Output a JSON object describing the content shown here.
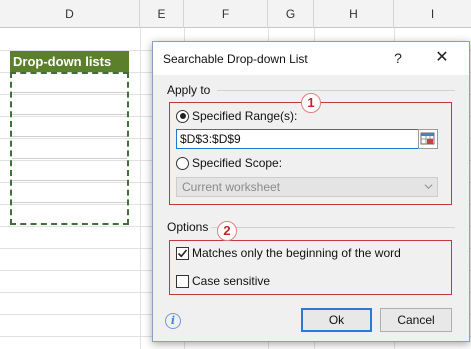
{
  "sheet": {
    "columns": [
      "D",
      "E",
      "F",
      "G",
      "H",
      "I"
    ],
    "header_cell": "Drop-down lists",
    "header_color": "#5b7f2a"
  },
  "dialog": {
    "title": "Searchable Drop-down List",
    "help_label": "?",
    "close_label": "✕",
    "apply_to": {
      "label": "Apply to",
      "badge": "1",
      "specified_range_label": "Specified Range(s):",
      "specified_range_checked": true,
      "range_value": "$D$3:$D$9",
      "specified_scope_label": "Specified Scope:",
      "specified_scope_checked": false,
      "scope_value": "Current worksheet"
    },
    "options": {
      "label": "Options",
      "badge": "2",
      "match_beginning_label": "Matches only the beginning of the word",
      "match_beginning_checked": true,
      "case_sensitive_label": "Case sensitive",
      "case_sensitive_checked": false
    },
    "info_icon": "info-icon",
    "ok_label": "Ok",
    "cancel_label": "Cancel",
    "accent_color": "#2c7ad6",
    "highlight_color": "#c0393b"
  }
}
